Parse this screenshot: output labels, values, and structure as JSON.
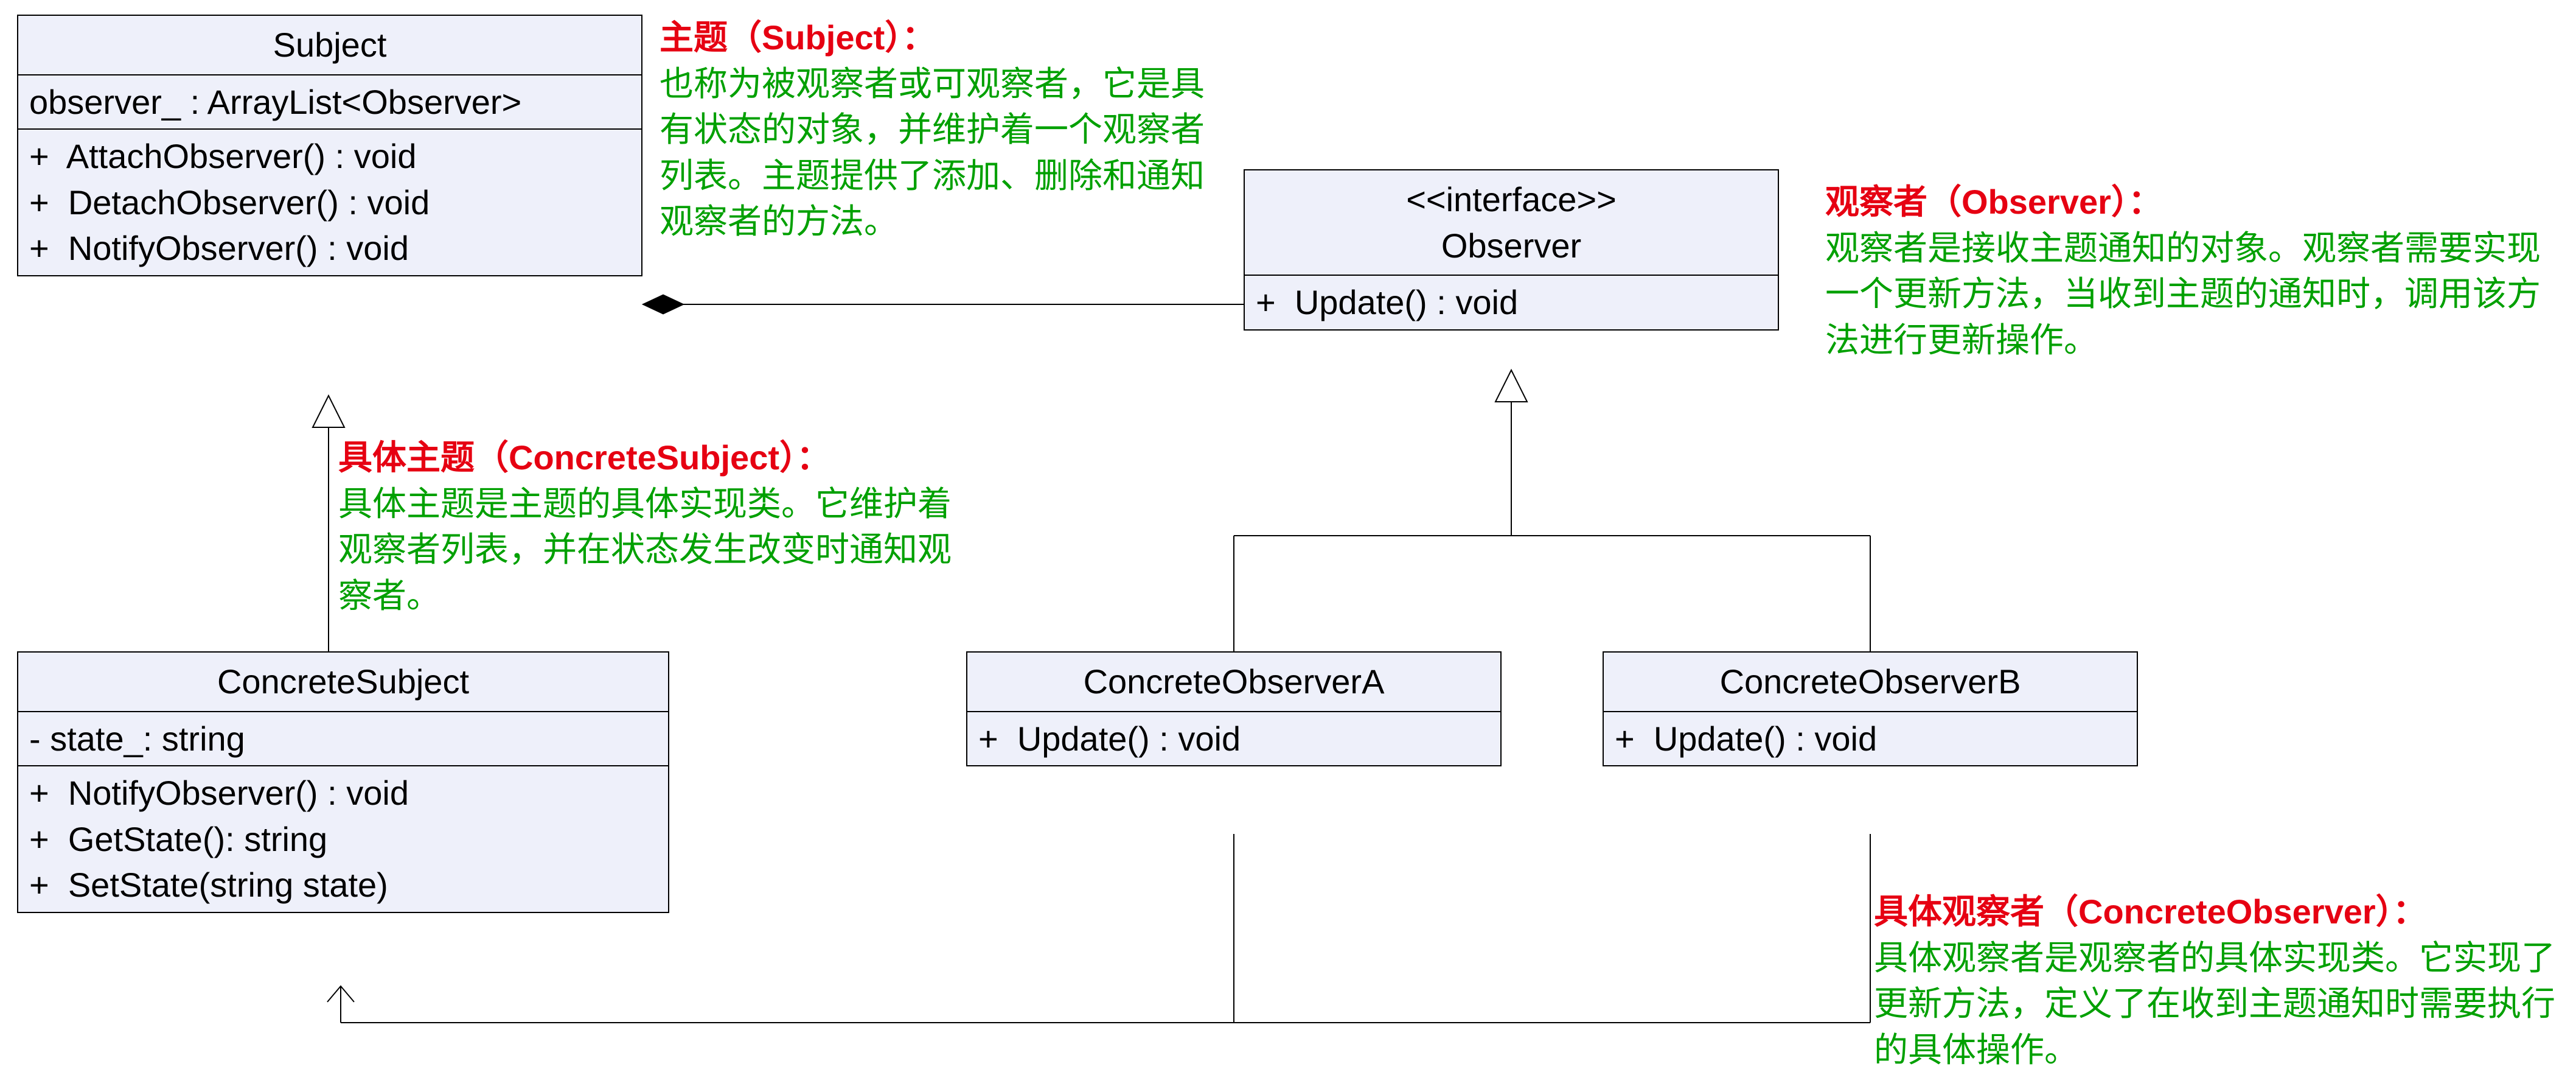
{
  "classes": {
    "subject": {
      "title": "Subject",
      "attr": "observer_ : ArrayList<Observer>",
      "ops": "+  AttachObserver() : void\n+  DetachObserver() : void\n+  NotifyObserver() : void"
    },
    "observer": {
      "stereo": "<<interface>>",
      "title": "Observer",
      "ops": "+  Update() : void"
    },
    "concreteSubject": {
      "title": "ConcreteSubject",
      "attr": "-  state_: string",
      "ops": "+  NotifyObserver() : void\n+  GetState(): string\n+  SetState(string state)"
    },
    "concreteObserverA": {
      "title": "ConcreteObserverA",
      "ops": "+  Update() : void"
    },
    "concreteObserverB": {
      "title": "ConcreteObserverB",
      "ops": "+  Update() : void"
    }
  },
  "annotations": {
    "subject": {
      "heading": "主题（Subject）：",
      "body": "也称为被观察者或可观察者，它是具有状态的对象，并维护着一个观察者列表。主题提供了添加、删除和通知观察者的方法。"
    },
    "observer": {
      "heading": "观察者（Observer）：",
      "body": "观察者是接收主题通知的对象。观察者需要实现一个更新方法，当收到主题的通知时，调用该方法进行更新操作。"
    },
    "concreteSubject": {
      "heading": "具体主题（ConcreteSubject）：",
      "body": "具体主题是主题的具体实现类。它维护着观察者列表，并在状态发生改变时通知观察者。"
    },
    "concreteObserver": {
      "heading": "具体观察者（ConcreteObserver）：",
      "body": "具体观察者是观察者的具体实现类。它实现了更新方法，定义了在收到主题通知时需要执行的具体操作。"
    }
  }
}
